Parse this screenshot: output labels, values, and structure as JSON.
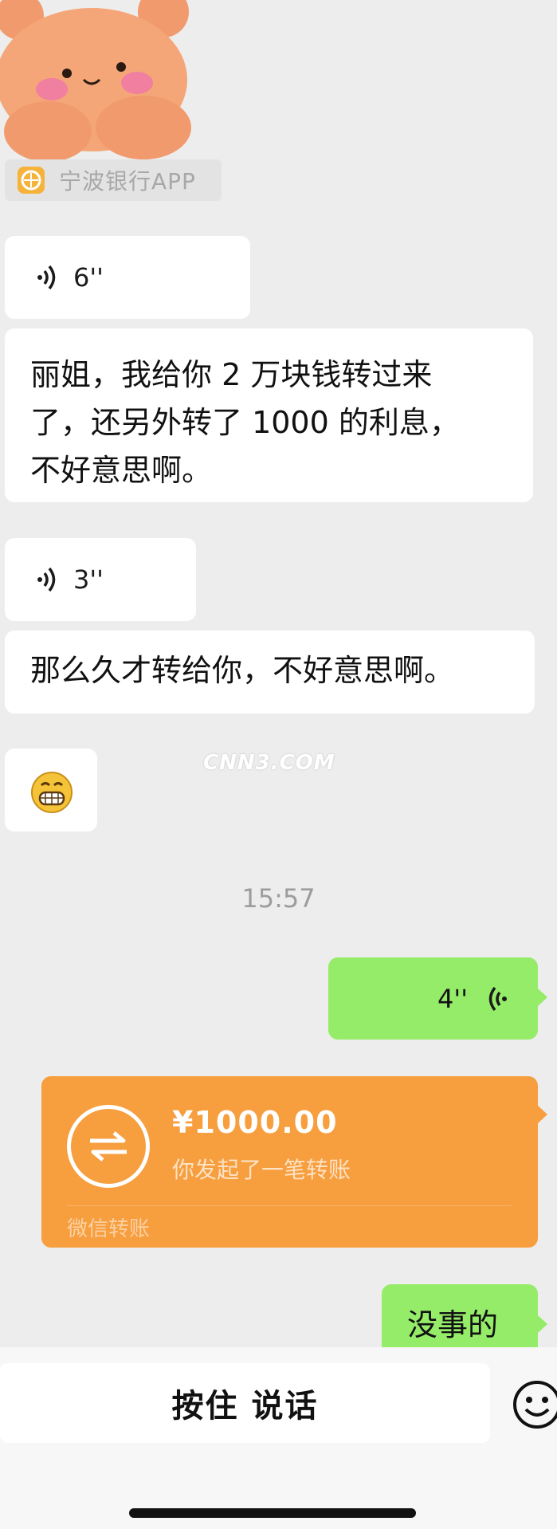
{
  "source_app": {
    "name": "宁波银行APP",
    "icon": "bank-logo-icon"
  },
  "messages": {
    "voice1": {
      "duration": "6''"
    },
    "text1": {
      "line1": "丽姐，我给你 2 万块钱转过来",
      "line2": "了，还另外转了 1000 的利息，",
      "line3": "不好意思啊。"
    },
    "voice2": {
      "duration": "3''"
    },
    "text2": {
      "text": "那么久才转给你，不好意思啊。"
    },
    "emoji1": {
      "icon": "grinning-face-emoji"
    },
    "timestamp": "15:57",
    "out_voice": {
      "duration": "4''"
    },
    "transfer": {
      "amount": "¥1000.00",
      "desc": "你发起了一笔转账",
      "label": "微信转账"
    },
    "out_text": {
      "text": "没事的"
    }
  },
  "watermark": "CNN3.COM",
  "input_bar": {
    "hold_to_talk": "按住 说话",
    "emoji_icon": "smiley-icon"
  },
  "colors": {
    "background": "#ededed",
    "outgoing": "#95ec69",
    "transfer": "#f79e3e"
  }
}
